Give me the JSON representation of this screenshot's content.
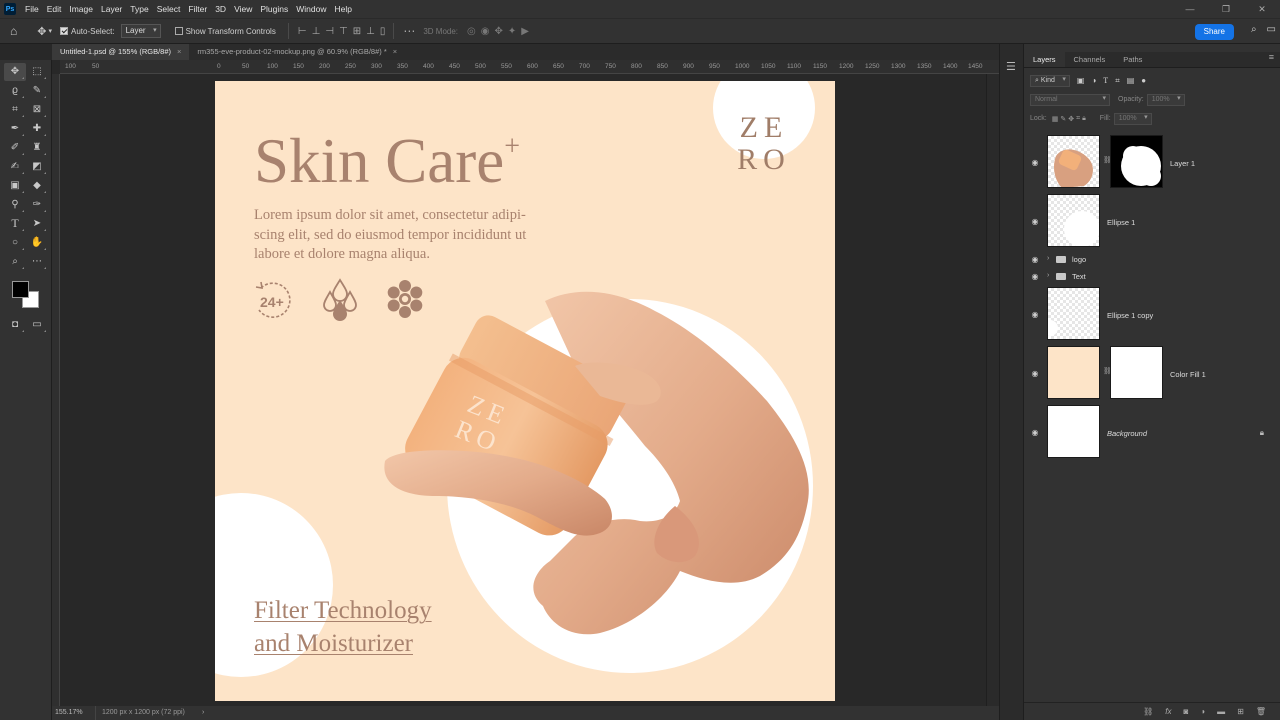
{
  "menu": [
    "File",
    "Edit",
    "Image",
    "Layer",
    "Type",
    "Select",
    "Filter",
    "3D",
    "View",
    "Plugins",
    "Window",
    "Help"
  ],
  "window_controls": [
    "—",
    "❐",
    "✕"
  ],
  "options": {
    "auto_select_label": "Auto-Select:",
    "auto_select_target": "Layer",
    "transform_label": "Show Transform Controls",
    "mode_3d_label": "3D Mode:",
    "share_label": "Share"
  },
  "doc_tabs": [
    {
      "title": "Untitled-1.psd @ 155% (RGB/8#)",
      "active": true
    },
    {
      "title": "rm355-eve-product-02-mockup.png @ 60.9% (RGB/8#) *",
      "active": false
    }
  ],
  "ruler_top": [
    "100",
    "50",
    "0",
    "50",
    "100",
    "150",
    "200",
    "250",
    "300",
    "350",
    "400",
    "450",
    "500",
    "550",
    "600",
    "650",
    "700",
    "750",
    "800",
    "850",
    "900",
    "950",
    "1000",
    "1050",
    "1100",
    "1150",
    "1200",
    "1250",
    "1300",
    "1350",
    "1400",
    "1450"
  ],
  "status": {
    "zoom": "155.17%",
    "dimensions": "1200 px x 1200 px (72 ppi)",
    "chevron": "›"
  },
  "artboard": {
    "logo_line1": "ZE",
    "logo_line2": "RO",
    "headline": "Skin Care",
    "headline_sup": "+",
    "body": "Lorem ipsum dolor sit amet, consectetur adipi-scing elit, sed do eiusmod tempor incididunt ut labore et dolore magna aliqua.",
    "body_lines": [
      "Lorem ipsum dolor sit amet, consectetur adipi-",
      "scing elit, sed do eiusmod tempor incididunt ut",
      "labore et dolore magna aliqua."
    ],
    "icon_24_label": "24+",
    "bottom_line1": "Filter Technology",
    "bottom_line2": "and Moisturizer",
    "jar_logo_line1": "ZE",
    "jar_logo_line2": "RO",
    "colors": {
      "background": "#fde4c8",
      "text": "#a8826e",
      "circle": "#ffffff"
    }
  },
  "layers_panel": {
    "tabs": [
      "Layers",
      "Channels",
      "Paths"
    ],
    "filter_kind": "Kind",
    "blend_mode": "Normal",
    "opacity_label": "Opacity:",
    "opacity_value": "100%",
    "lock_label": "Lock:",
    "fill_label": "Fill:",
    "fill_value": "100%",
    "layers": [
      {
        "name": "Layer 1"
      },
      {
        "name": "Ellipse 1"
      },
      {
        "name": "logo"
      },
      {
        "name": "Text"
      },
      {
        "name": "Ellipse 1 copy"
      },
      {
        "name": "Color Fill 1"
      },
      {
        "name": "Background"
      }
    ]
  }
}
